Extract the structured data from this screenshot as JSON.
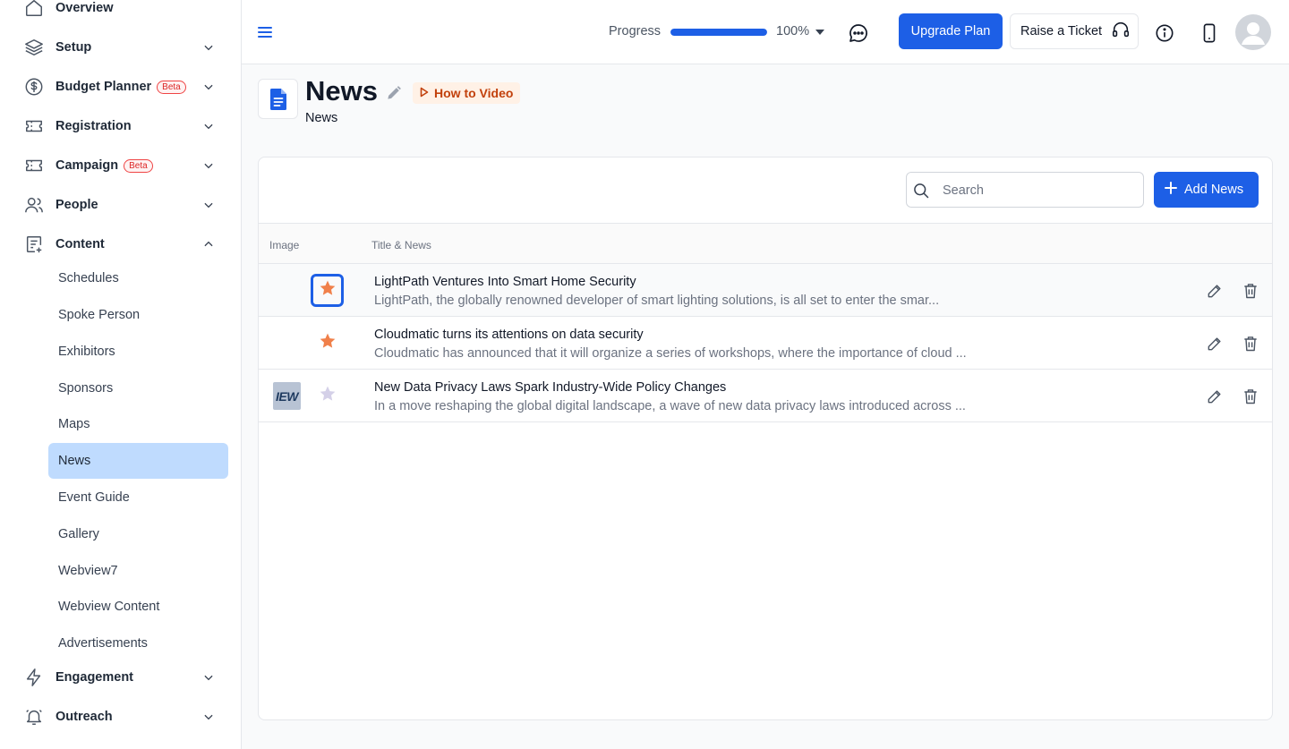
{
  "sidebar": {
    "items": [
      {
        "label": "Overview",
        "icon": "home-icon"
      },
      {
        "label": "Setup",
        "icon": "layers-icon"
      },
      {
        "label": "Budget Planner",
        "badge": "Beta",
        "icon": "dollar-circle-icon"
      },
      {
        "label": "Registration",
        "icon": "ticket-icon"
      },
      {
        "label": "Campaign",
        "badge": "Beta",
        "icon": "ticket-icon"
      },
      {
        "label": "People",
        "icon": "users-icon"
      },
      {
        "label": "Content",
        "icon": "content-icon"
      },
      {
        "label": "Engagement",
        "icon": "bolt-icon"
      },
      {
        "label": "Outreach",
        "icon": "bell-icon"
      }
    ],
    "content_subitems": [
      "Schedules",
      "Spoke Person",
      "Exhibitors",
      "Sponsors",
      "Maps",
      "News",
      "Event Guide",
      "Gallery",
      "Webview7",
      "Webview Content",
      "Advertisements"
    ],
    "active_subitem": "News"
  },
  "topbar": {
    "progress_label": "Progress",
    "progress_value": "100%",
    "progress_fraction": 1.0,
    "upgrade_label": "Upgrade Plan",
    "ticket_label": "Raise a Ticket"
  },
  "page": {
    "title": "News",
    "subtitle": "News",
    "how_to_label": "How to Video"
  },
  "toolbar": {
    "search_placeholder": "Search",
    "add_label": "Add News"
  },
  "table": {
    "columns": [
      "Image",
      "Title & News"
    ],
    "rows": [
      {
        "title": "LightPath Ventures Into Smart Home Security",
        "description": "LightPath, the globally renowned developer of smart lighting solutions, is all set to enter the smar...",
        "featured": true,
        "thumbnail": null
      },
      {
        "title": "Cloudmatic turns its attentions on data security",
        "description": "Cloudmatic has announced that it will organize a series of workshops, where the importance of cloud ...",
        "featured": true,
        "thumbnail": null
      },
      {
        "title": "New Data Privacy Laws Spark Industry-Wide Policy Changes",
        "description": "In a move reshaping the global digital landscape, a wave of new data privacy laws introduced across ...",
        "featured": false,
        "thumbnail": "IEW"
      }
    ]
  },
  "colors": {
    "accent": "#1d5fe6",
    "active_bg": "#bfdbfe",
    "star_on": "#f0804a",
    "star_off": "#d4d0e8",
    "how_to_text": "#c2410c"
  }
}
